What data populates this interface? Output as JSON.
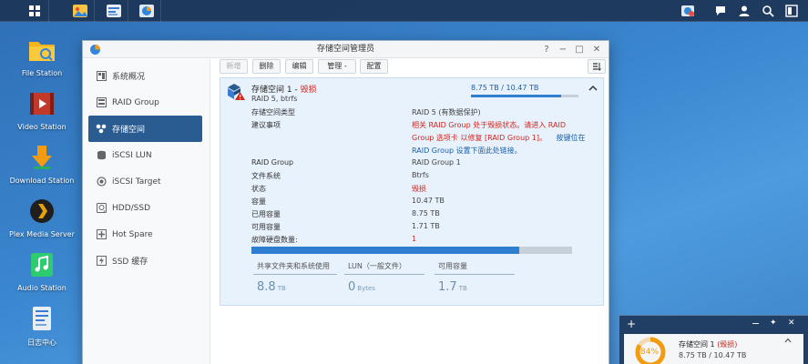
{
  "window": {
    "title": "存储空间管理员"
  },
  "desktop_icons": [
    {
      "label": "File Station"
    },
    {
      "label": "Video Station"
    },
    {
      "label": "Download Station"
    },
    {
      "label": "Plex Media Server"
    },
    {
      "label": "Audio Station"
    },
    {
      "label": "日志中心"
    }
  ],
  "sidebar": {
    "items": [
      {
        "label": "系统概况"
      },
      {
        "label": "RAID Group"
      },
      {
        "label": "存储空间"
      },
      {
        "label": "iSCSI LUN"
      },
      {
        "label": "iSCSI Target"
      },
      {
        "label": "HDD/SSD"
      },
      {
        "label": "Hot Spare"
      },
      {
        "label": "SSD 缓存"
      }
    ]
  },
  "toolbar": {
    "new": "新增",
    "delete": "删除",
    "edit": "编辑",
    "manage": "管理 -",
    "config": "配置"
  },
  "volume": {
    "name": "存储空间 1",
    "separator": " - ",
    "status_short": "毁损",
    "subtitle": "RAID 5, btrfs",
    "usage_text": "8.75 TB / 10.47 TB",
    "usage_fraction": 0.836,
    "details": [
      {
        "label": "存储空间类型",
        "value": "RAID 5 (有数据保护)"
      },
      {
        "label": "建议事项",
        "value": ""
      },
      {
        "label": "RAID Group",
        "value": "RAID Group 1"
      },
      {
        "label": "文件系统",
        "value": "Btrfs"
      },
      {
        "label": "状态",
        "value": "毁损"
      },
      {
        "label": "容量",
        "value": "10.47 TB"
      },
      {
        "label": "已用容量",
        "value": "8.75 TB"
      },
      {
        "label": "可用容量",
        "value": "1.71 TB"
      },
      {
        "label": "故障硬盘数量:",
        "value": "1"
      }
    ],
    "advice_line1": "相关 RAID Group 处于毁损状态。请进入 RAID",
    "advice_line2": "Group 选项卡 以修复 [RAID Group 1]。",
    "advice_link1": "按键位在",
    "advice_link2": "RAID Group 设置下面此处链接。",
    "bottom_bar_fraction": 0.835,
    "stats": [
      {
        "title": "共享文件夹和系统使用",
        "value": "8.8",
        "unit": "TB"
      },
      {
        "title": "LUN（一般文件）",
        "value": "0",
        "unit": "Bytes"
      },
      {
        "title": "可用容量",
        "value": "1.7",
        "unit": "TB"
      }
    ]
  },
  "widget": {
    "percent": "84%",
    "title": "存储空间 1",
    "status": "(毁损)",
    "usage": "8.75 TB / 10.47 TB",
    "add": "+",
    "minimize": "−",
    "pin": "✦",
    "close": "✕"
  },
  "colors": {
    "accent": "#2f7fd1",
    "active_nav": "#2b5c91",
    "danger": "#d0261c",
    "link": "#1a5fa8"
  }
}
